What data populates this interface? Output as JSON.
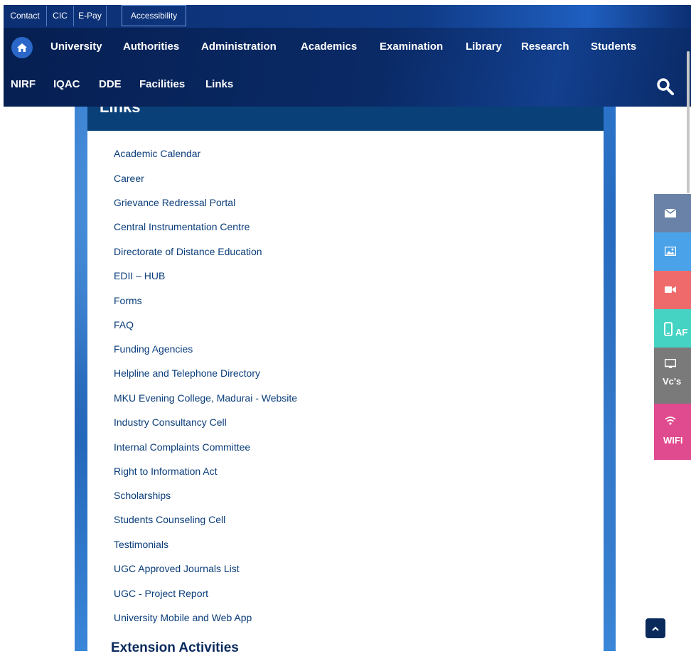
{
  "topbar": {
    "links": [
      "Contact",
      "CIC",
      "E-Pay",
      "Accessibility"
    ]
  },
  "nav": {
    "row1": [
      "University",
      "Authorities",
      "Administration",
      "Academics",
      "Examination",
      "Library",
      "Research",
      "Students"
    ],
    "row2": [
      "NIRF",
      "IQAC",
      "DDE",
      "Facilities",
      "Links"
    ]
  },
  "panel": {
    "title": "Links",
    "links": [
      "Academic Calendar",
      "Career",
      "Grievance Redressal Portal",
      "Central Instrumentation Centre",
      "Directorate of Distance Education",
      "EDII – HUB",
      "Forms",
      "FAQ",
      "Funding Agencies",
      "Helpline and Telephone Directory",
      "MKU Evening College, Madurai - Website",
      "Industry Consultancy Cell",
      "Internal Complaints Committee",
      "Right to Information Act",
      "Scholarships",
      "Students Counseling Cell",
      "Testimonials",
      "UGC Approved Journals List",
      "UGC - Project Report",
      "University Mobile and Web App"
    ],
    "next_section": "Extension Activities"
  },
  "side_buttons": {
    "app_label": "AF",
    "vc_label": "Vc's",
    "wifi_label": "WIFI",
    "colors": {
      "mail": "#6a82a8",
      "gallery": "#4aa3e8",
      "video": "#ef6b6b",
      "app": "#45d4c4",
      "vc": "#7a7a7a",
      "wifi": "#e04a8e"
    }
  }
}
